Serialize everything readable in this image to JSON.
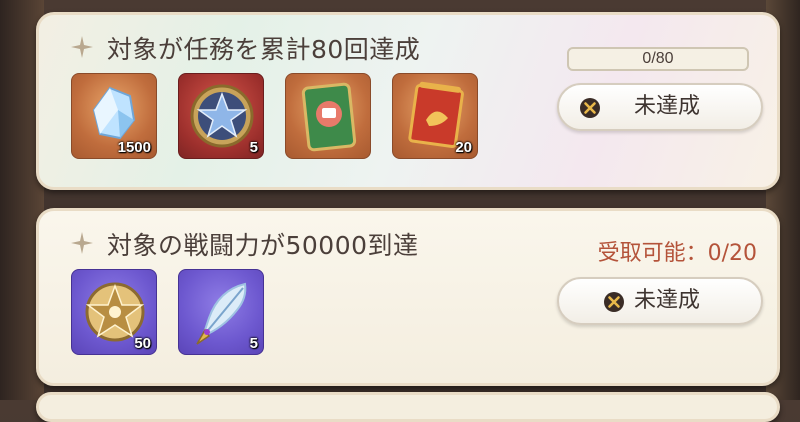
{
  "quests": [
    {
      "title": "対象が任務を累計80回達成",
      "progress": {
        "text": "0/80",
        "current": 0,
        "total": 80
      },
      "status_label": "未達成",
      "rewards": [
        {
          "icon": "blue-crystal-icon",
          "quantity": "1500"
        },
        {
          "icon": "star-medal-icon",
          "quantity": "5"
        },
        {
          "icon": "green-card-icon",
          "quantity": ""
        },
        {
          "icon": "red-scroll-icon",
          "quantity": "20"
        }
      ]
    },
    {
      "title": "対象の戦闘力が50000到達",
      "claimable": "受取可能：0/20",
      "status_label": "未達成",
      "rewards": [
        {
          "icon": "gold-star-badge-icon",
          "quantity": "50"
        },
        {
          "icon": "feather-quill-icon",
          "quantity": "5"
        }
      ]
    }
  ],
  "colors": {
    "gold_frame": "#c06d3d",
    "purple_frame": "#6d58cf",
    "claimable_text": "#b4533a",
    "title_text": "#4b3f3a"
  }
}
